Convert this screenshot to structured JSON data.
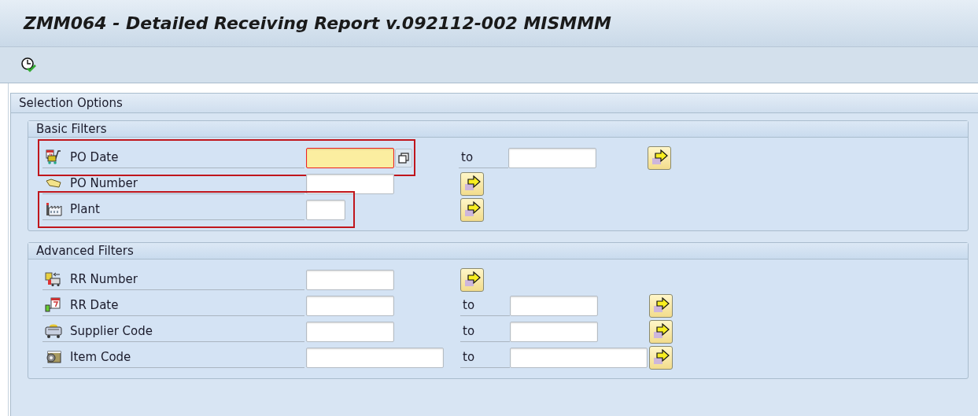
{
  "window": {
    "title": "ZMM064 - Detailed Receiving Report v.092112-002 MISMMM"
  },
  "selection": {
    "title": "Selection Options",
    "groups": [
      {
        "title": "Basic Filters",
        "rows": [
          {
            "label": "PO Date",
            "kind": "range",
            "focused": true,
            "value_help": true,
            "highlighted": true,
            "to_label": "to",
            "wide": false
          },
          {
            "label": "PO Number",
            "kind": "single",
            "focused": false,
            "value_help": false,
            "highlighted": false,
            "wide": false
          },
          {
            "label": "Plant",
            "kind": "single",
            "focused": false,
            "value_help": false,
            "highlighted": true,
            "wide": false,
            "short": true
          }
        ]
      },
      {
        "title": "Advanced Filters",
        "rows": [
          {
            "label": "RR Number",
            "kind": "single",
            "focused": false,
            "value_help": false,
            "highlighted": false,
            "wide": false
          },
          {
            "label": "RR Date",
            "kind": "range",
            "focused": false,
            "value_help": false,
            "highlighted": false,
            "to_label": "to",
            "wide": false
          },
          {
            "label": "Supplier Code",
            "kind": "range",
            "focused": false,
            "value_help": false,
            "highlighted": false,
            "to_label": "to",
            "wide": false
          },
          {
            "label": "Item Code",
            "kind": "range",
            "focused": false,
            "value_help": false,
            "highlighted": false,
            "to_label": "to",
            "wide": true
          }
        ]
      }
    ]
  }
}
